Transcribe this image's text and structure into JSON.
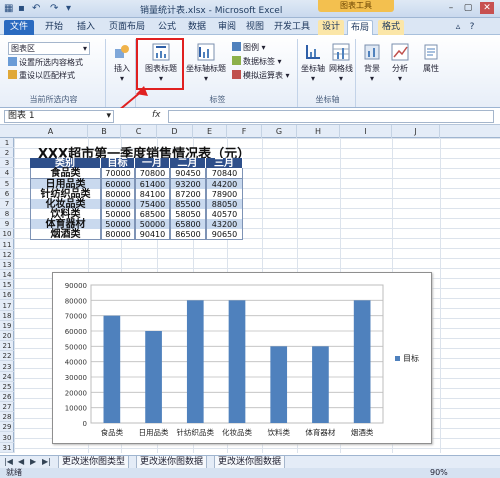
{
  "titlebar": {
    "file": "销量统计表.xlsx",
    "separator": " - ",
    "app": "Microsoft Excel",
    "context_group": "图表工具",
    "min": "–",
    "max": "▢",
    "close": "✕"
  },
  "tabs": [
    "文件",
    "开始",
    "插入",
    "页面布局",
    "公式",
    "数据",
    "审阅",
    "视图",
    "开发工具",
    "设计",
    "布局",
    "格式"
  ],
  "active_tab": "布局",
  "ribbon": {
    "current_selection": {
      "dropdown": "图表区",
      "format_selection": "设置所选内容格式",
      "reset_style": "重设以匹配样式",
      "label": "当前所选内容"
    },
    "insert": {
      "label": "插入"
    },
    "labels_group": {
      "chart_title": "图表标题",
      "axis_titles": "坐标轴标题",
      "legend": "图例",
      "data_labels": "数据标签",
      "data_table": "模拟运算表",
      "label": "标签"
    },
    "axes_group": {
      "axes": "坐标轴",
      "gridlines": "网格线",
      "label": "坐标轴"
    },
    "background": "背景",
    "analysis": "分析",
    "properties": "属性"
  },
  "formula_bar": {
    "name_box": "图表 1",
    "fx": "fx",
    "value": ""
  },
  "columns": [
    "A",
    "B",
    "C",
    "D",
    "E",
    "F",
    "G",
    "H",
    "I",
    "J"
  ],
  "rows": [
    "1",
    "2",
    "3",
    "4",
    "5",
    "6",
    "7",
    "8",
    "9",
    "10",
    "11",
    "12",
    "13",
    "14",
    "15",
    "16",
    "17",
    "18",
    "19",
    "20",
    "21",
    "22",
    "23",
    "24",
    "25",
    "26",
    "27",
    "28",
    "29",
    "30",
    "31"
  ],
  "table": {
    "title": "XXX超市第一季度销售情况表（元）",
    "headers": [
      "类别",
      "目标",
      "一月",
      "二月",
      "三月"
    ],
    "rows": [
      [
        "食品类",
        "70000",
        "70800",
        "90450",
        "70840"
      ],
      [
        "日用品类",
        "60000",
        "61400",
        "93200",
        "44200"
      ],
      [
        "针纺织品类",
        "80000",
        "84100",
        "87200",
        "78900"
      ],
      [
        "化妆品类",
        "80000",
        "75400",
        "85500",
        "88050"
      ],
      [
        "饮料类",
        "50000",
        "68500",
        "58050",
        "40570"
      ],
      [
        "体育器材",
        "50000",
        "50000",
        "65800",
        "43200"
      ],
      [
        "烟酒类",
        "80000",
        "90410",
        "86500",
        "90650"
      ]
    ]
  },
  "chart_data": {
    "type": "bar",
    "categories": [
      "食品类",
      "日用品类",
      "针纺织品类",
      "化妆品类",
      "饮料类",
      "体育器材",
      "烟酒类"
    ],
    "series": [
      {
        "name": "目标",
        "values": [
          70000,
          60000,
          80000,
          80000,
          50000,
          50000,
          80000
        ],
        "color": "#4f81bd"
      }
    ],
    "yticks": [
      "0",
      "10000",
      "20000",
      "30000",
      "40000",
      "50000",
      "60000",
      "70000",
      "80000",
      "90000"
    ],
    "ylim": [
      0,
      90000
    ],
    "grid": true,
    "legend": "right"
  },
  "sheet_tabs": [
    "更改迷你图类型",
    "更改迷你图数据",
    "更改迷你图数据"
  ],
  "status": {
    "mode": "就绪",
    "zoom": "90%"
  }
}
